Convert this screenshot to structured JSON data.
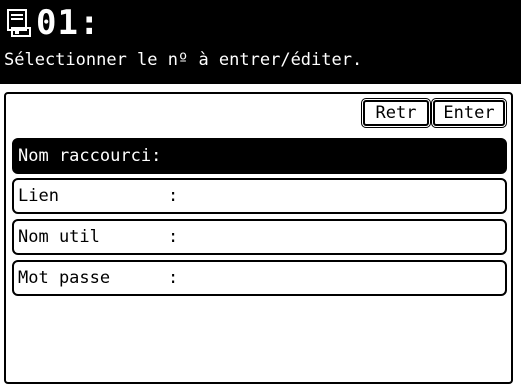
{
  "header": {
    "number": "01:",
    "subtitle": "Sélectionner le nº à entrer/éditer."
  },
  "buttons": {
    "retr": "Retr",
    "enter": "Enter"
  },
  "rows": [
    {
      "label": "Nom raccourci",
      "colon": ":"
    },
    {
      "label": "Lien",
      "colon": ":"
    },
    {
      "label": "Nom util",
      "colon": ":"
    },
    {
      "label": "Mot passe",
      "colon": ":"
    }
  ],
  "icons": {
    "header_icon": "document-icon"
  }
}
